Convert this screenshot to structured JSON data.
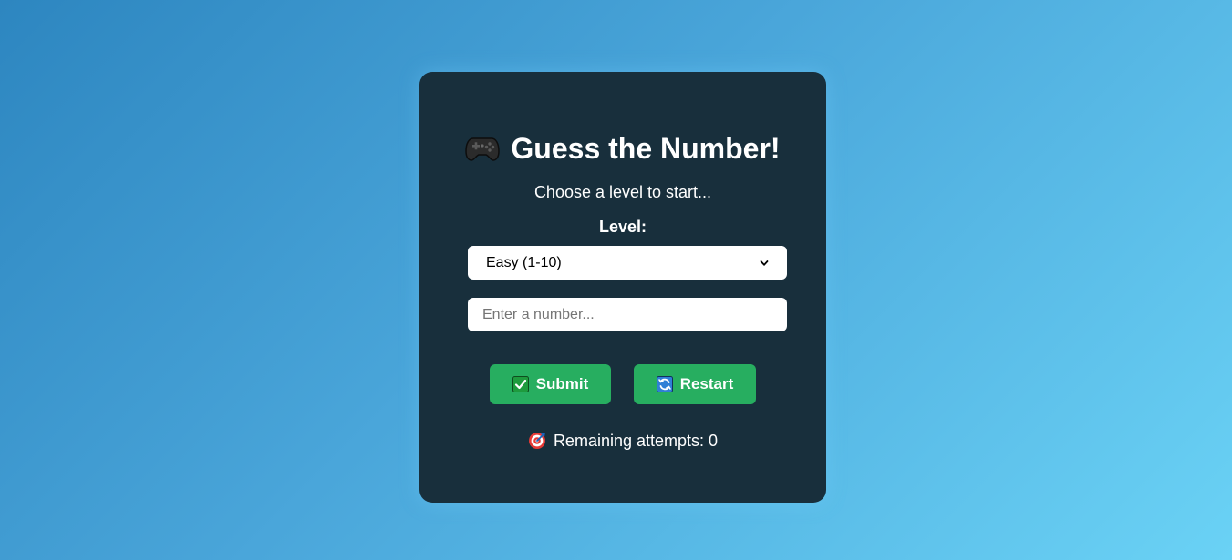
{
  "game": {
    "title": "Guess the Number!",
    "title_icon": "gamepad-icon",
    "subtitle": "Choose a level to start...",
    "level_label": "Level:",
    "level_selected": "Easy (1-10)",
    "input_placeholder": "Enter a number...",
    "submit_label": "Submit",
    "submit_icon": "check-icon",
    "restart_label": "Restart",
    "restart_icon": "refresh-icon",
    "attempts_label": "Remaining attempts:",
    "attempts_value": "0",
    "attempts_icon": "target-icon"
  },
  "colors": {
    "card_bg": "#182f3c",
    "button_green": "#27ae60",
    "background_start": "#2d86c0",
    "background_end": "#6ad2f5"
  }
}
